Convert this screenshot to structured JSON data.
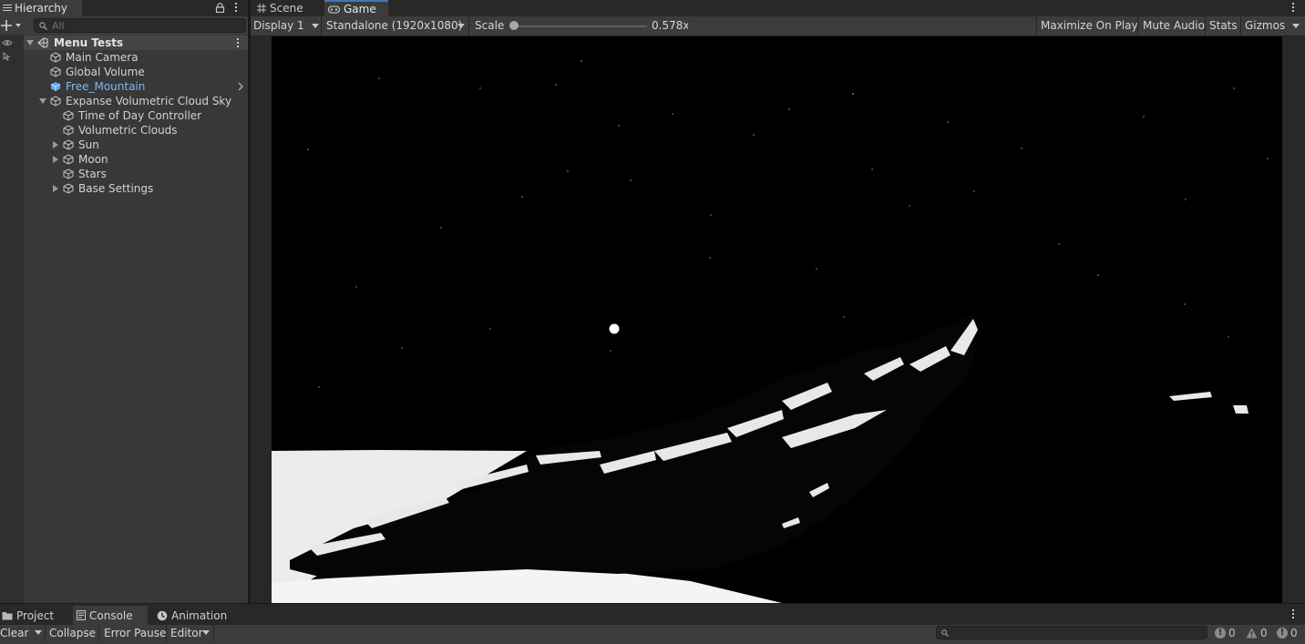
{
  "hierarchy": {
    "tab_label": "Hierarchy",
    "search_placeholder": "All",
    "scene_name": "Menu Tests",
    "items": [
      {
        "label": "Main Camera"
      },
      {
        "label": "Global Volume"
      },
      {
        "label": "Free_Mountain"
      },
      {
        "label": "Expanse Volumetric Cloud Sky"
      },
      {
        "label": "Time of Day Controller"
      },
      {
        "label": "Volumetric Clouds"
      },
      {
        "label": "Sun"
      },
      {
        "label": "Moon"
      },
      {
        "label": "Stars"
      },
      {
        "label": "Base Settings"
      }
    ]
  },
  "game_view": {
    "tabs": [
      "Scene",
      "Game"
    ],
    "display": "Display 1",
    "resolution": "Standalone (1920x1080)",
    "scale_label": "Scale",
    "scale_value": "0.578x",
    "scale_fraction": 0.02,
    "maximize": "Maximize On Play",
    "mute": "Mute Audio",
    "stats": "Stats",
    "gizmos": "Gizmos"
  },
  "bottom": {
    "tabs": [
      "Project",
      "Console",
      "Animation"
    ],
    "clear": "Clear",
    "collapse": "Collapse",
    "error_pause": "Error Pause",
    "editor": "Editor",
    "counts": {
      "info": "0",
      "warning": "0",
      "error": "0"
    }
  },
  "colors": {
    "accent": "#3a79bb",
    "prefab_blue": "#7cb8f7",
    "panel": "#383838",
    "toolbar": "#3c3c3c"
  }
}
